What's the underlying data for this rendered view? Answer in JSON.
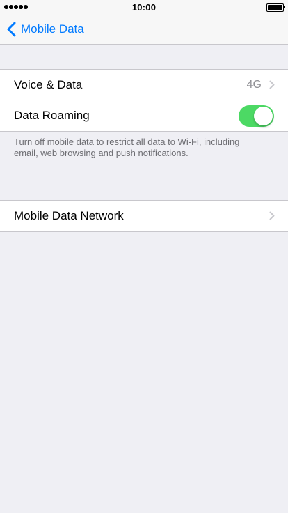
{
  "status_bar": {
    "time": "10:00",
    "signal_bars": 5,
    "battery_level": 1.0
  },
  "nav": {
    "back_label": "Mobile Data"
  },
  "group1": {
    "rows": [
      {
        "label": "Voice & Data",
        "value": "4G"
      },
      {
        "label": "Data Roaming",
        "toggle_on": true
      }
    ],
    "footer": "Turn off mobile data to restrict all data to Wi-Fi, including email, web browsing and push notifications."
  },
  "group2": {
    "rows": [
      {
        "label": "Mobile Data Network"
      }
    ]
  },
  "colors": {
    "accent": "#007aff",
    "toggle_on": "#4cd964",
    "background": "#efeff4"
  },
  "icons": {
    "back": "chevron-left-icon",
    "disclosure": "chevron-right-icon",
    "battery": "battery-icon",
    "signal": "signal-strength-icon"
  }
}
